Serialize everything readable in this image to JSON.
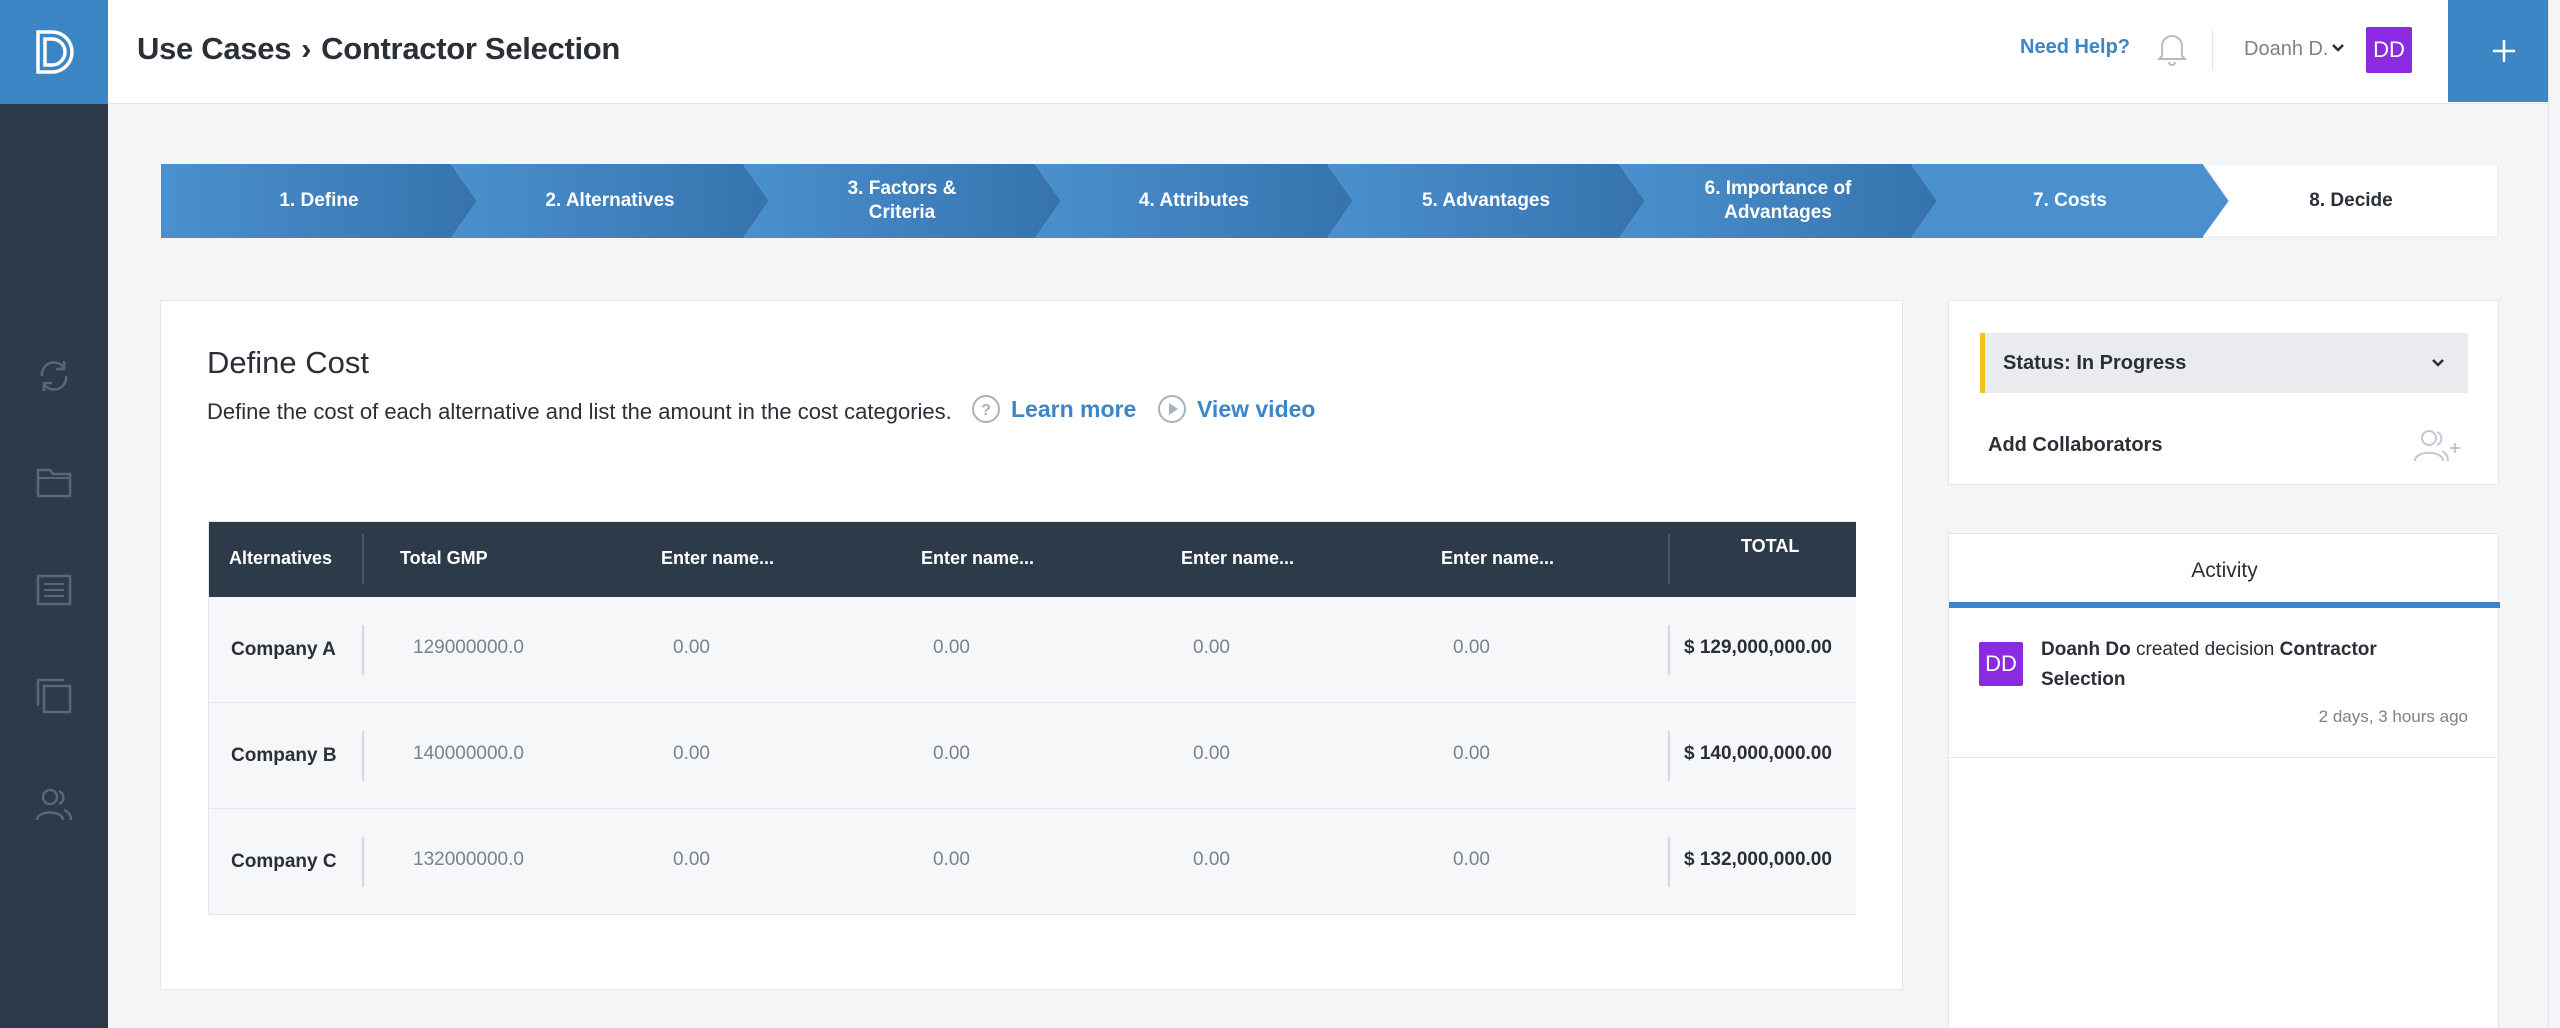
{
  "header": {
    "breadcrumb_root": "Use Cases",
    "breadcrumb_sep": "›",
    "breadcrumb_current": "Contractor Selection",
    "help_label": "Need Help?",
    "user_name": "Doanh D.",
    "user_initials": "DD"
  },
  "sidebar": {
    "icons": [
      "refresh-icon",
      "folder-icon",
      "list-icon",
      "copy-icon",
      "users-icon"
    ]
  },
  "steps": [
    {
      "label": "1. Define"
    },
    {
      "label": "2. Alternatives"
    },
    {
      "label": "3. Factors &\nCriteria"
    },
    {
      "label": "4. Attributes"
    },
    {
      "label": "5. Advantages"
    },
    {
      "label": "6. Importance of\nAdvantages"
    },
    {
      "label": "7. Costs"
    },
    {
      "label": "8. Decide"
    }
  ],
  "main": {
    "title": "Define Cost",
    "description": "Define the cost of each alternative and list the amount in the cost categories.",
    "learn_more": "Learn more",
    "view_video": "View video",
    "table": {
      "headers": {
        "alternatives": "Alternatives",
        "col1": "Total GMP",
        "col2": "Enter name...",
        "col3": "Enter name...",
        "col4": "Enter name...",
        "col5": "Enter name...",
        "total": "TOTAL"
      },
      "rows": [
        {
          "name": "Company A",
          "gmp": "129000000.0",
          "c2": "0.00",
          "c3": "0.00",
          "c4": "0.00",
          "c5": "0.00",
          "total": "$ 129,000,000.00"
        },
        {
          "name": "Company B",
          "gmp": "140000000.0",
          "c2": "0.00",
          "c3": "0.00",
          "c4": "0.00",
          "c5": "0.00",
          "total": "$ 140,000,000.00"
        },
        {
          "name": "Company C",
          "gmp": "132000000.0",
          "c2": "0.00",
          "c3": "0.00",
          "c4": "0.00",
          "c5": "0.00",
          "total": "$ 132,000,000.00"
        }
      ]
    }
  },
  "status": {
    "label": "Status: In Progress",
    "add_collaborators": "Add Collaborators"
  },
  "activity": {
    "tab": "Activity",
    "items": [
      {
        "initials": "DD",
        "actor": "Doanh Do",
        "action": "created decision",
        "object": "Contractor Selection",
        "time": "2 days, 3 hours ago"
      }
    ]
  },
  "colors": {
    "brand_blue": "#3d86c6",
    "sidebar_dark": "#2d3a4a",
    "avatar_purple": "#8a2be2",
    "status_yellow": "#f0c419"
  }
}
